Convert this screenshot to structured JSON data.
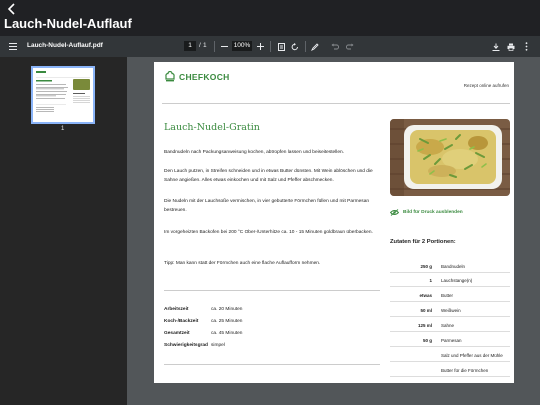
{
  "app": {
    "title": "Lauch-Nudel-Auflauf"
  },
  "toolbar": {
    "filename": "Lauch-Nudel-Auflauf.pdf",
    "current_page": "1",
    "page_sep": "/",
    "total_pages": "1",
    "zoom": "100%"
  },
  "sidebar": {
    "thumbnail_number": "1"
  },
  "document": {
    "brand": "CHEFKOCH",
    "online_link": "Rezept online aufrufen",
    "title": "Lauch-Nudel-Gratin",
    "paragraphs": [
      "Bandnudeln nach Packungsanweisung kochen, abtropfen lassen und beiseitestellen.",
      "Den Lauch putzen, in Streifen schneiden und in etwas Butter dünsten. Mit Wein ablöschen und die Sahne angießen. Alles etwas einkochen und mit Salz und Pfeffer abschmecken.",
      "Die Nudeln mit der Lauchsoße vermischen, in vier gebutterte Förmchen füllen und mit Parmesan bestreuen.",
      "Im vorgeheizten Backofen bei 200 °C Ober-/Unterhitze ca. 10 - 15 Minuten goldbraun überbacken.",
      "Tipp: Man kann statt der Förmchen auch eine flache Auflaufform nehmen."
    ],
    "info": [
      {
        "label": "Arbeitszeit",
        "value": "ca. 20 Minuten"
      },
      {
        "label": "Koch-/Backzeit",
        "value": "ca. 25 Minuten"
      },
      {
        "label": "Gesamtzeit",
        "value": "ca. 45 Minuten"
      },
      {
        "label": "Schwierigkeitsgrad",
        "value": "simpel"
      }
    ],
    "hide_image_label": "Bild für Druck ausblenden",
    "servings_heading": "Zutaten für 2 Portionen:",
    "ingredients": [
      {
        "qty": "250 g",
        "name": "Bandnudeln"
      },
      {
        "qty": "1",
        "name": "Lauchstange(n)"
      },
      {
        "qty": "etwas",
        "name": "Butter"
      },
      {
        "qty": "50 ml",
        "name": "Weißwein"
      },
      {
        "qty": "125 ml",
        "name": "Sahne"
      },
      {
        "qty": "50 g",
        "name": "Parmesan"
      },
      {
        "qty": "",
        "name": "Salz und Pfeffer aus der Mühle"
      },
      {
        "qty": "",
        "name": "Butter für die Förmchen"
      }
    ]
  },
  "colors": {
    "brand_green": "#3a8a3f",
    "toolbar": "#323639",
    "viewer_bg": "#525659",
    "sidebar_bg": "#262626",
    "thumb_border": "#8ab4f8"
  }
}
